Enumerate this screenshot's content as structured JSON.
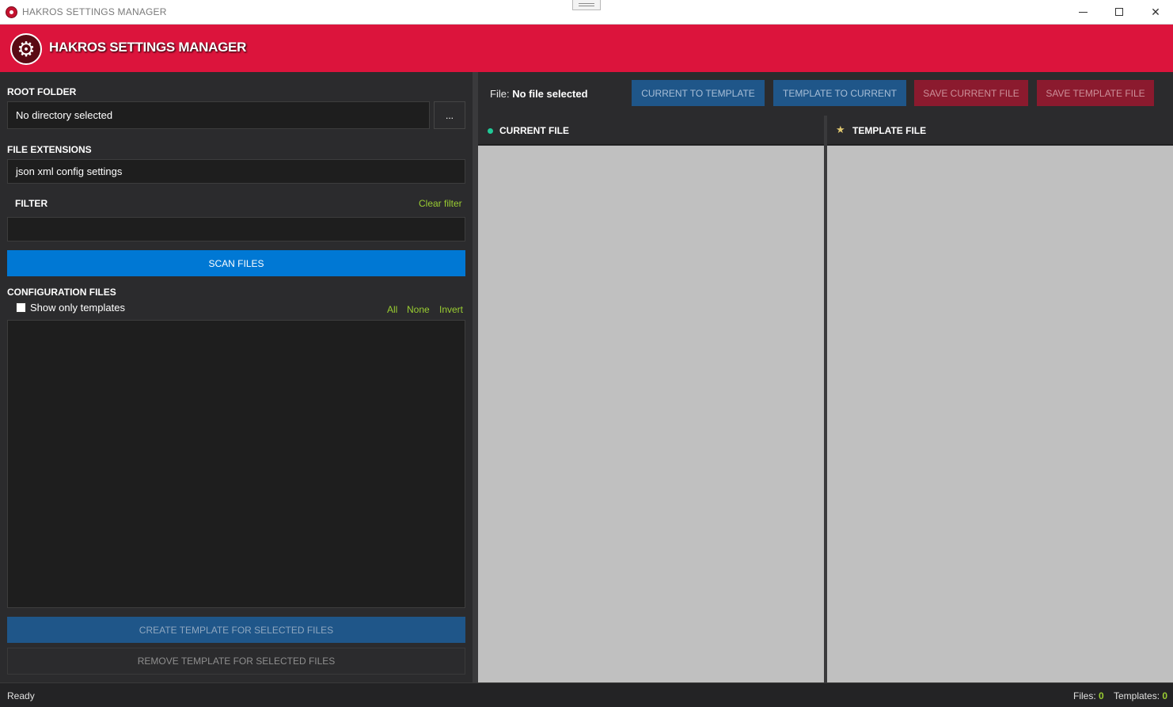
{
  "window": {
    "title": "HAKROS SETTINGS MANAGER",
    "grip_icon": "drag-handle-icon"
  },
  "header": {
    "title": "HAKROS SETTINGS MANAGER",
    "logo_icon": "gear-icon",
    "accent_color": "#dc143c"
  },
  "left_panel": {
    "root_folder": {
      "label": "ROOT FOLDER",
      "value": "No directory selected",
      "browse_label": "..."
    },
    "file_extensions": {
      "label": "FILE EXTENSIONS",
      "value": "json xml config settings"
    },
    "filter": {
      "label": "FILTER",
      "clear_label": "Clear filter",
      "value": ""
    },
    "scan_label": "SCAN FILES",
    "configuration_files": {
      "label": "CONFIGURATION FILES",
      "show_only_templates": "Show only templates",
      "show_only_templates_checked": false,
      "select_all": "All",
      "select_none": "None",
      "select_invert": "Invert",
      "items": []
    },
    "create_template_label": "CREATE TEMPLATE FOR SELECTED FILES",
    "remove_template_label": "REMOVE TEMPLATE FOR SELECTED FILES"
  },
  "toolbar": {
    "file_prefix": "File:",
    "file_value": "No file selected",
    "current_to_template": "CURRENT TO TEMPLATE",
    "template_to_current": "TEMPLATE TO CURRENT",
    "save_current": "SAVE CURRENT FILE",
    "save_template": "SAVE TEMPLATE FILE"
  },
  "panes": {
    "current": {
      "title": "CURRENT FILE",
      "icon": "dot-icon"
    },
    "template": {
      "title": "TEMPLATE FILE",
      "icon": "star-icon"
    }
  },
  "statusbar": {
    "status": "Ready",
    "files_label": "Files:",
    "files_count": "0",
    "templates_label": "Templates:",
    "templates_count": "0"
  }
}
